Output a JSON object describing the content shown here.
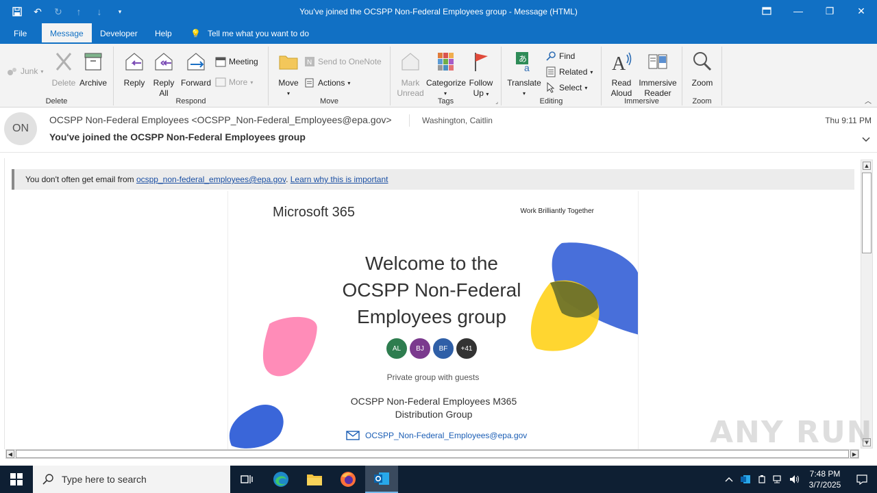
{
  "window": {
    "title": "You've joined the OCSPP Non-Federal Employees group  -  Message (HTML)"
  },
  "tabs": {
    "file": "File",
    "message": "Message",
    "developer": "Developer",
    "help": "Help",
    "tell_me": "Tell me what you want to do"
  },
  "ribbon": {
    "delete_group": {
      "label": "Delete",
      "junk": "Junk",
      "delete": "Delete",
      "archive": "Archive"
    },
    "respond_group": {
      "label": "Respond",
      "reply": "Reply",
      "reply_all_1": "Reply",
      "reply_all_2": "All",
      "forward": "Forward",
      "meeting": "Meeting",
      "more": "More"
    },
    "move_group": {
      "label": "Move",
      "move": "Move",
      "send_to_onenote": "Send to OneNote",
      "actions": "Actions"
    },
    "tags_group": {
      "label": "Tags",
      "mark_unread_1": "Mark",
      "mark_unread_2": "Unread",
      "categorize": "Categorize",
      "follow_up_1": "Follow",
      "follow_up_2": "Up"
    },
    "editing_group": {
      "label": "Editing",
      "translate": "Translate",
      "find": "Find",
      "related": "Related",
      "select": "Select"
    },
    "immersive_group": {
      "label": "Immersive",
      "read_aloud_1": "Read",
      "read_aloud_2": "Aloud",
      "immersive_reader_1": "Immersive",
      "immersive_reader_2": "Reader"
    },
    "zoom_group": {
      "label": "Zoom",
      "zoom": "Zoom"
    }
  },
  "message": {
    "avatar_initials": "ON",
    "from": "OCSPP Non-Federal Employees <OCSPP_Non-Federal_Employees@epa.gov>",
    "to": "Washington, Caitlin",
    "subject": "You've joined the OCSPP Non-Federal Employees group",
    "time": "Thu 9:11 PM"
  },
  "notice": {
    "prefix": "You don't often get email from ",
    "email_link": "ocspp_non-federal_employees@epa.gov",
    "suffix": ". ",
    "learn_link": "Learn why this is important"
  },
  "email_body": {
    "brand": "Microsoft 365",
    "tagline": "Work Brilliantly Together",
    "welcome": "Welcome to the OCSPP Non-Federal Employees group",
    "members": [
      {
        "initials": "AL",
        "color": "#2e7d4f"
      },
      {
        "initials": "BJ",
        "color": "#7b3a8e"
      },
      {
        "initials": "BF",
        "color": "#2f5fa7"
      },
      {
        "initials": "+41",
        "color": "#333333"
      }
    ],
    "privacy": "Private group with guests",
    "group_name": "OCSPP Non-Federal Employees M365 Distribution Group",
    "group_email": "OCSPP_Non-Federal_Employees@epa.gov"
  },
  "watermark": "ANY RUN",
  "taskbar": {
    "search_placeholder": "Type here to search",
    "time": "7:48 PM",
    "date": "3/7/2025"
  },
  "colors": {
    "accent": "#1170c4",
    "link": "#1a4fa3"
  }
}
